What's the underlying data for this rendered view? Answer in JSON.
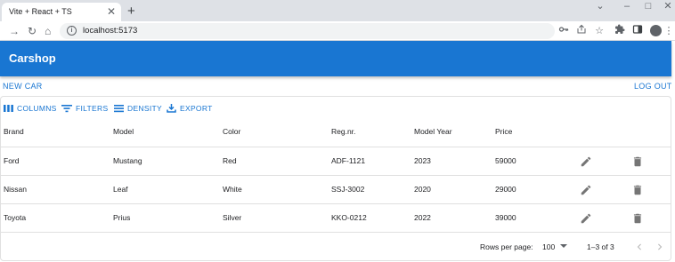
{
  "browser": {
    "tab_title": "Vite + React + TS",
    "url": "localhost:5173"
  },
  "app": {
    "title": "Carshop",
    "new_car_label": "NEW CAR",
    "logout_label": "LOG OUT"
  },
  "grid_toolbar": {
    "columns_label": "COLUMNS",
    "filters_label": "FILTERS",
    "density_label": "DENSITY",
    "export_label": "EXPORT"
  },
  "table": {
    "headers": [
      "Brand",
      "Model",
      "Color",
      "Reg.nr.",
      "Model Year",
      "Price"
    ],
    "rows": [
      [
        "Ford",
        "Mustang",
        "Red",
        "ADF-1121",
        "2023",
        "59000"
      ],
      [
        "Nissan",
        "Leaf",
        "White",
        "SSJ-3002",
        "2020",
        "29000"
      ],
      [
        "Toyota",
        "Prius",
        "Silver",
        "KKO-0212",
        "2022",
        "39000"
      ]
    ]
  },
  "footer": {
    "rows_per_page_label": "Rows per page:",
    "rows_per_page_value": "100",
    "range_text": "1–3 of 3"
  },
  "colors": {
    "primary": "#1976d2",
    "icon_gray": "#757575"
  }
}
